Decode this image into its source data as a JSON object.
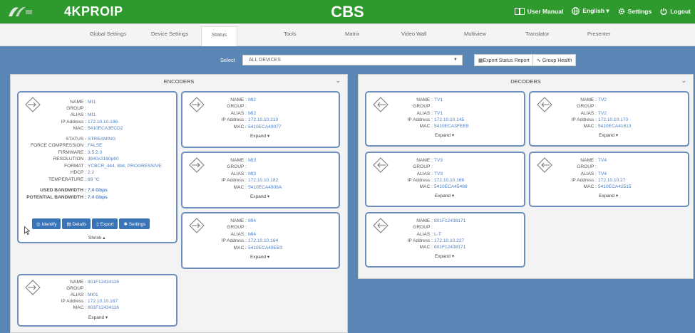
{
  "app": {
    "product": "4KPROIP",
    "title": "CBS"
  },
  "topnav": {
    "manual": "User Manual",
    "language": "English ▾",
    "settings": "Settings",
    "logout": "Logout"
  },
  "tabs": [
    "Global Settings",
    "Device Settings",
    "Status",
    "Tools",
    "Matrix",
    "Video Wall",
    "Multiview",
    "Translator",
    "Presenter"
  ],
  "active_tab": "Status",
  "toolbar": {
    "select_label": "Select",
    "select_value": "ALL DEVICES",
    "export_btn": "Export Status Report",
    "health_btn": "Group Health"
  },
  "encoders": {
    "title": "ENCODERS",
    "labels": {
      "name": "NAME :",
      "group": "GROUP :",
      "alias": "ALIAS :",
      "ip": "IP Address :",
      "mac": "MAC :",
      "expand": "Expand ▾",
      "shrink": "Shrink ▴"
    },
    "expanded": {
      "name": "MI1",
      "group": "",
      "alias": "MI1",
      "ip": "172.10.10.186",
      "mac": "5410ECA3ECD2",
      "status_label": "STATUS :",
      "status": "STREAMING",
      "force_label": "FORCE COMPRESSION :",
      "force": "FALSE",
      "fw_label": "FIRMWARE :",
      "fw": "3.5.2.0",
      "res_label": "RESOLUTION :",
      "res": "3840x2160p60",
      "fmt_label": "FORMAT :",
      "fmt": "YCBCR_444, 8bit, PROGRESSIVE",
      "hdcp_label": "HDCP :",
      "hdcp": "2.2",
      "temp_label": "TEMPERATURE :",
      "temp": "69 °C",
      "used_label": "USED BANDWIDTH :",
      "used": "7.4 Gbps",
      "pot_label": "POTENTIAL BANDWIDTH :",
      "pot": "7.4 Gbps",
      "actions": {
        "identify": "Identify",
        "details": "Details",
        "export": "Export",
        "settings": "Settings"
      }
    },
    "cards": [
      {
        "name": "MI2",
        "group": "",
        "alias": "MI2",
        "ip": "172.10.10.210",
        "mac": "5410ECA49077"
      },
      {
        "name": "MI3",
        "group": "",
        "alias": "MI3",
        "ip": "172.10.10.182",
        "mac": "5410ECA4908A"
      },
      {
        "name": "MI4",
        "group": "",
        "alias": "MI4",
        "ip": "172.10.10.164",
        "mac": "5410ECA49EB3"
      },
      {
        "name": "801F12434116",
        "group": "",
        "alias": "MI01",
        "ip": "172.10.10.167",
        "mac": "801F12434116"
      }
    ]
  },
  "decoders": {
    "title": "DECODERS",
    "cards": [
      {
        "name": "TV1",
        "group": "",
        "alias": "TV1",
        "ip": "172.10.10.145",
        "mac": "5410ECA3FEE9"
      },
      {
        "name": "TV2",
        "group": "",
        "alias": "TV2",
        "ip": "172.10.10.170",
        "mac": "5410ECA41613"
      },
      {
        "name": "TV3",
        "group": "",
        "alias": "TV3",
        "ip": "172.10.10.166",
        "mac": "5410ECA45488"
      },
      {
        "name": "TV4",
        "group": "",
        "alias": "TV4",
        "ip": "172.10.10.27",
        "mac": "5410ECA42515"
      },
      {
        "name": "801F12438171",
        "group": "",
        "alias": "L-T",
        "ip": "172.10.10.227",
        "mac": "801F12438171"
      }
    ]
  }
}
